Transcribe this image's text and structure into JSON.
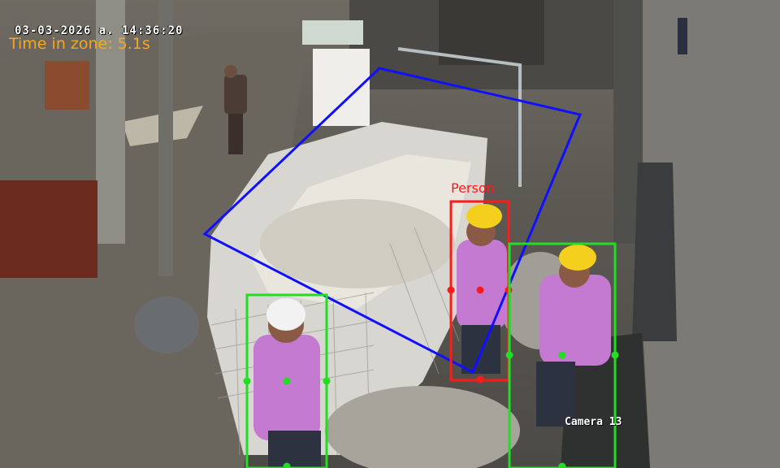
{
  "overlay": {
    "timestamp": "03-03-2026 a.  14:36:20",
    "zone_timer": "Time in zone: 5.1s",
    "camera_label": "Camera 13"
  },
  "detections": [
    {
      "label": "Person",
      "status": "in-zone",
      "color": "#ff1a1a"
    },
    {
      "label": "",
      "status": "outside-zone",
      "color": "#22dd22"
    },
    {
      "label": "",
      "status": "outside-zone",
      "color": "#22dd22"
    }
  ],
  "zone": {
    "color": "#1010ff"
  },
  "colors": {
    "timer_text": "#f5a623",
    "timestamp_text": "#ffffff",
    "alert_box": "#ff1a1a",
    "normal_box": "#22dd22",
    "zone_outline": "#1010ff"
  }
}
